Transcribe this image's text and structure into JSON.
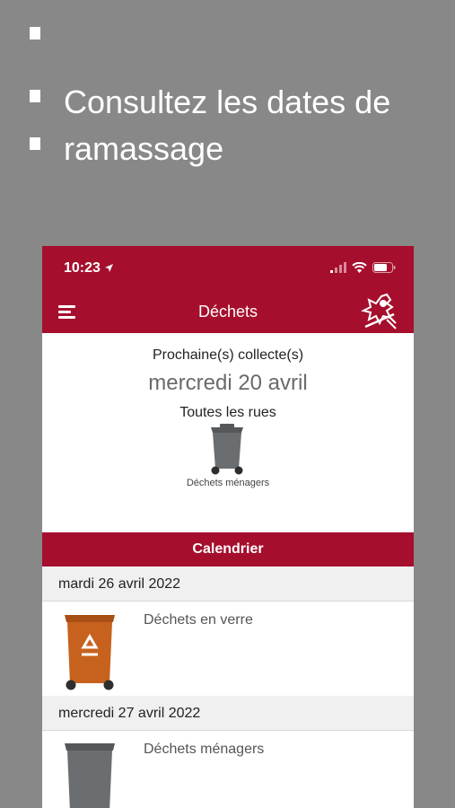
{
  "promo": {
    "line1": "Consultez les dates de",
    "line2": "ramassage"
  },
  "status_bar": {
    "time": "10:23"
  },
  "header": {
    "title": "Déchets"
  },
  "next_collection": {
    "label": "Prochaine(s) collecte(s)",
    "date": "mercredi 20 avril",
    "streets": "Toutes les rues",
    "bin_label": "Déchets ménagers",
    "bin_color": "#6b6e71"
  },
  "calendar": {
    "title": "Calendrier",
    "days": [
      {
        "date": "mardi 26 avril 2022",
        "entry": "Déchets en verre",
        "bin_color": "#c7621e"
      },
      {
        "date": "mercredi 27 avril 2022",
        "entry": "Déchets ménagers",
        "bin_color": "#6b6e71"
      }
    ]
  },
  "colors": {
    "accent": "#a50f2d",
    "background": "#888888"
  }
}
